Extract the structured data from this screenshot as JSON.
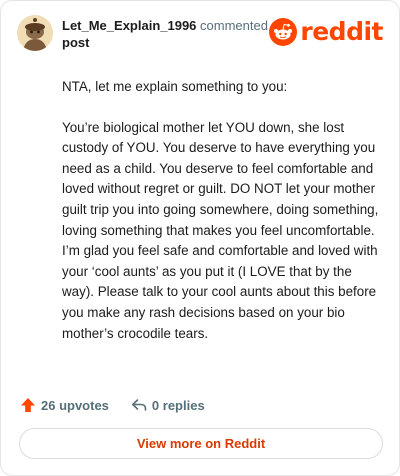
{
  "header": {
    "username": "Let_Me_Explain_1996",
    "commented_text": "commented on",
    "post_link": "post",
    "logo_text": "reddit"
  },
  "comment": {
    "paragraphs": [
      "NTA, let me explain something to you:",
      "You’re biological mother let YOU down, she lost custody of YOU. You deserve to have everything you need as a child. You deserve to feel comfortable and loved without regret or guilt. DO NOT let your mother guilt trip you into going somewhere, doing something, loving something that makes you feel uncomfortable. I’m glad you feel safe and comfortable and loved with your ‘cool aunts’ as you put it (I LOVE that by the way). Please talk to your cool aunts about this before you make any rash decisions based on your bio mother’s crocodile tears."
    ]
  },
  "stats": {
    "upvotes": "26 upvotes",
    "replies": "0 replies"
  },
  "footer": {
    "view_more": "View more on Reddit"
  },
  "colors": {
    "brand": "#ff4500",
    "link_text": "#d93a00",
    "muted": "#576f76"
  },
  "icons": {
    "avatar": "snoo-avatar-icon",
    "logo": "reddit-snoo-icon",
    "upvote": "upvote-arrow-icon",
    "reply": "reply-arrow-icon"
  }
}
